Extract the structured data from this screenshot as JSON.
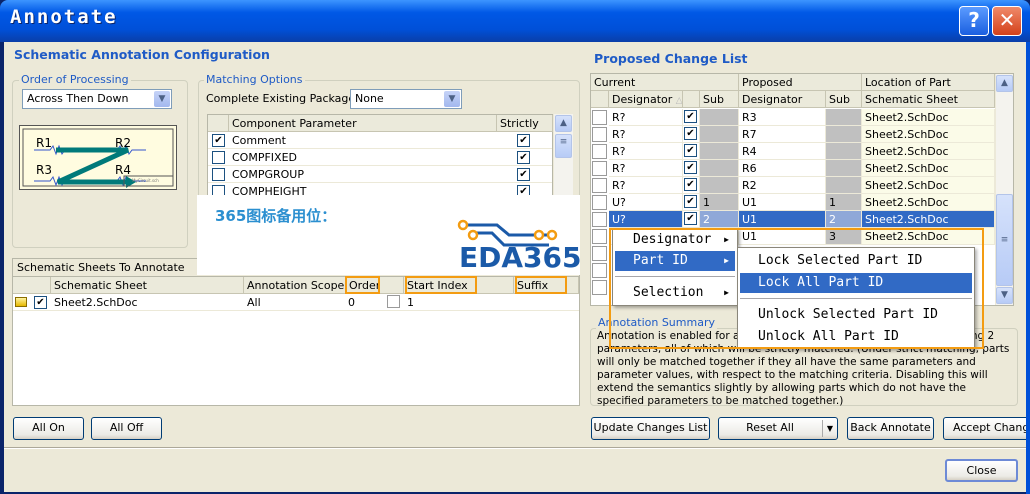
{
  "window": {
    "title": "Annotate",
    "help_label": "?",
    "close_label": "✕"
  },
  "left": {
    "heading": "Schematic Annotation Configuration",
    "order_group": "Order of Processing",
    "order_value": "Across Then Down",
    "preview_labels": [
      "R1",
      "R2",
      "R3",
      "R4"
    ],
    "preview_footer": "MyCircuit.sch",
    "matching_group": "Matching Options",
    "complete_packages_label": "Complete Existing Packages",
    "complete_packages_value": "None",
    "param_headers": [
      "Component Parameter",
      "Strictly"
    ],
    "params": [
      {
        "name": "Comment",
        "checked": true,
        "strictly": true
      },
      {
        "name": "COMPFIXED",
        "checked": false,
        "strictly": true
      },
      {
        "name": "COMPGROUP",
        "checked": false,
        "strictly": true
      },
      {
        "name": "COMPHEIGHT",
        "checked": false,
        "strictly": true
      }
    ],
    "sheets_title": "Schematic Sheets To Annotate",
    "sheet_headers": [
      "Schematic Sheet",
      "Annotation Scope",
      "Order",
      "Start Index",
      "Suffix"
    ],
    "sheets": [
      {
        "sheet": "Sheet2.SchDoc",
        "scope": "All",
        "order": "0",
        "start_index": "1",
        "suffix": ""
      }
    ]
  },
  "watermark": {
    "text": "365图标备用位：",
    "logo": "EDA365"
  },
  "right": {
    "heading": "Proposed Change List",
    "group_headers": [
      "Current",
      "Proposed",
      "Location of Part"
    ],
    "col_headers": [
      "Designator",
      "Sub",
      "Designator",
      "Sub",
      "Schematic Sheet"
    ],
    "rows": [
      {
        "cur": "R?",
        "csub": "",
        "prop": "R3",
        "psub": "",
        "sheet": "Sheet2.SchDoc"
      },
      {
        "cur": "R?",
        "csub": "",
        "prop": "R7",
        "psub": "",
        "sheet": "Sheet2.SchDoc"
      },
      {
        "cur": "R?",
        "csub": "",
        "prop": "R4",
        "psub": "",
        "sheet": "Sheet2.SchDoc"
      },
      {
        "cur": "R?",
        "csub": "",
        "prop": "R6",
        "psub": "",
        "sheet": "Sheet2.SchDoc"
      },
      {
        "cur": "R?",
        "csub": "",
        "prop": "R2",
        "psub": "",
        "sheet": "Sheet2.SchDoc"
      },
      {
        "cur": "U?",
        "csub": "1",
        "prop": "U1",
        "psub": "1",
        "sheet": "Sheet2.SchDoc"
      },
      {
        "cur": "U?",
        "csub": "2",
        "prop": "U1",
        "psub": "2",
        "sheet": "Sheet2.SchDoc",
        "selected": true
      },
      {
        "cur": "",
        "csub": "",
        "prop": "U1",
        "psub": "3",
        "sheet": "Sheet2.SchDoc"
      }
    ],
    "summary_group": "Annotation Summary",
    "summary_text": "Annotation is enabled for all schematic parts. Parts will be matched using 2 parameters, all of which will be strictly matched. (Under strict matching, parts will only be matched together if they all have the same parameters and parameter values, with respect to the matching criteria. Disabling this will extend the semantics slightly by allowing parts which do not have the specified parameters to be matched together.)"
  },
  "context_menu": {
    "items": [
      "Designator",
      "Part ID",
      "Selection"
    ],
    "highlighted": "Part ID"
  },
  "submenu": {
    "items": [
      "Lock Selected Part ID",
      "Lock All Part ID",
      "Unlock Selected Part ID",
      "Unlock All Part ID"
    ],
    "highlighted": "Lock All Part ID"
  },
  "buttons": {
    "all_on": "All On",
    "all_off": "All Off",
    "update": "Update Changes List",
    "reset": "Reset All",
    "back_annotate": "Back Annotate",
    "accept": "Accept Changes",
    "close": "Close"
  },
  "colors": {
    "accent": "#1f5bc6",
    "selection": "#316ac5",
    "highlight_box": "#f39c12",
    "sheet_cell": "#fbfbe8"
  }
}
